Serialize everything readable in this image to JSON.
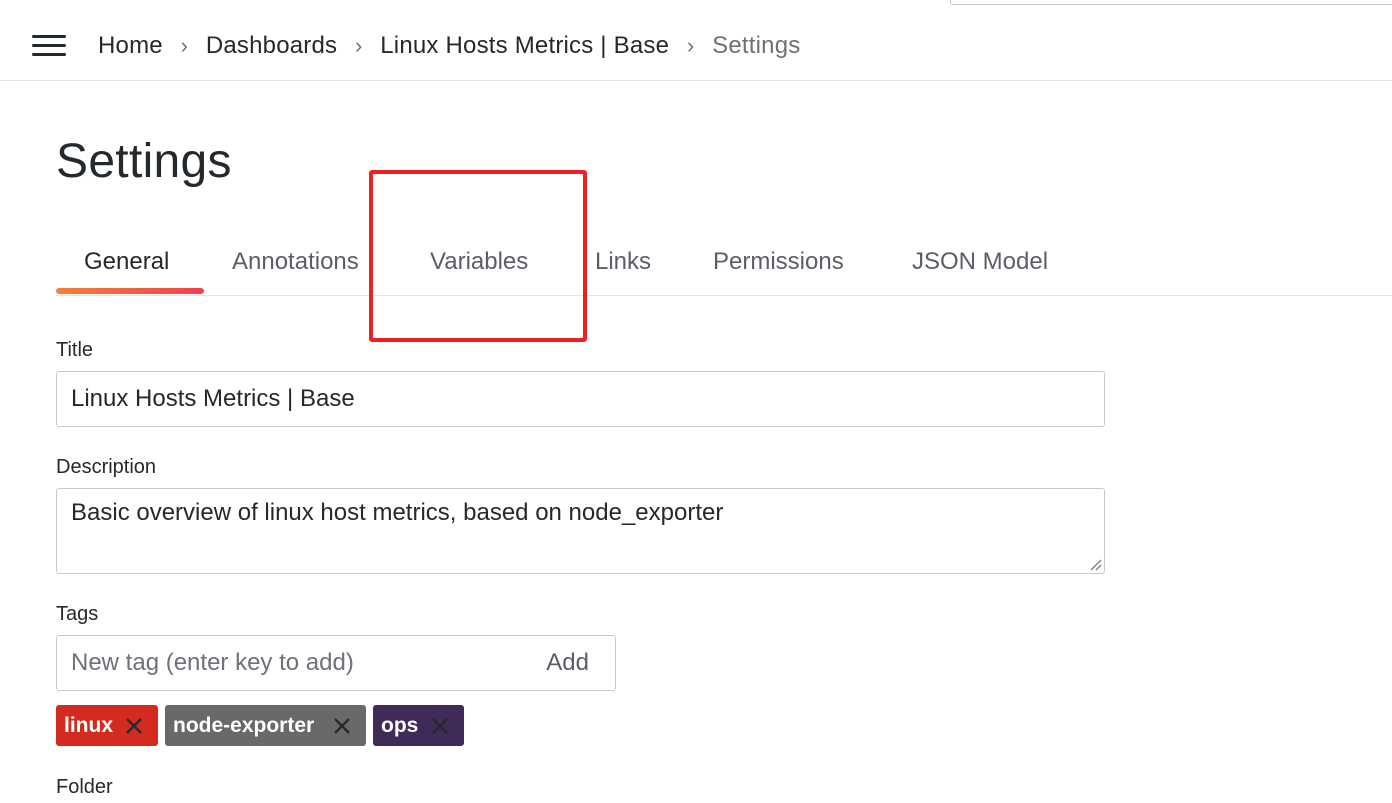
{
  "breadcrumb": {
    "items": [
      "Home",
      "Dashboards",
      "Linux Hosts Metrics | Base",
      "Settings"
    ],
    "separator": "›"
  },
  "page": {
    "title": "Settings"
  },
  "tabs": [
    {
      "label": "General",
      "active": true
    },
    {
      "label": "Annotations",
      "active": false
    },
    {
      "label": "Variables",
      "active": false
    },
    {
      "label": "Links",
      "active": false
    },
    {
      "label": "Permissions",
      "active": false
    },
    {
      "label": "JSON Model",
      "active": false
    }
  ],
  "form": {
    "title_label": "Title",
    "title_value": "Linux Hosts Metrics | Base",
    "description_label": "Description",
    "description_value": "Basic overview of linux host metrics, based on node_exporter",
    "tags_label": "Tags",
    "tag_placeholder": "New tag (enter key to add)",
    "tag_add_label": "Add",
    "tags": [
      {
        "label": "linux",
        "color": "#d42b20"
      },
      {
        "label": "node-exporter",
        "color": "#696969"
      },
      {
        "label": "ops",
        "color": "#3f2a58"
      }
    ],
    "folder_label": "Folder"
  },
  "colors": {
    "highlight": "#ee2020",
    "tab_underline_start": "#f57f3a",
    "tab_underline_end": "#f0414c"
  },
  "icons": {
    "menu": "hamburger-menu-icon",
    "tag_remove": "close-icon",
    "resize": "resize-grip-icon"
  }
}
